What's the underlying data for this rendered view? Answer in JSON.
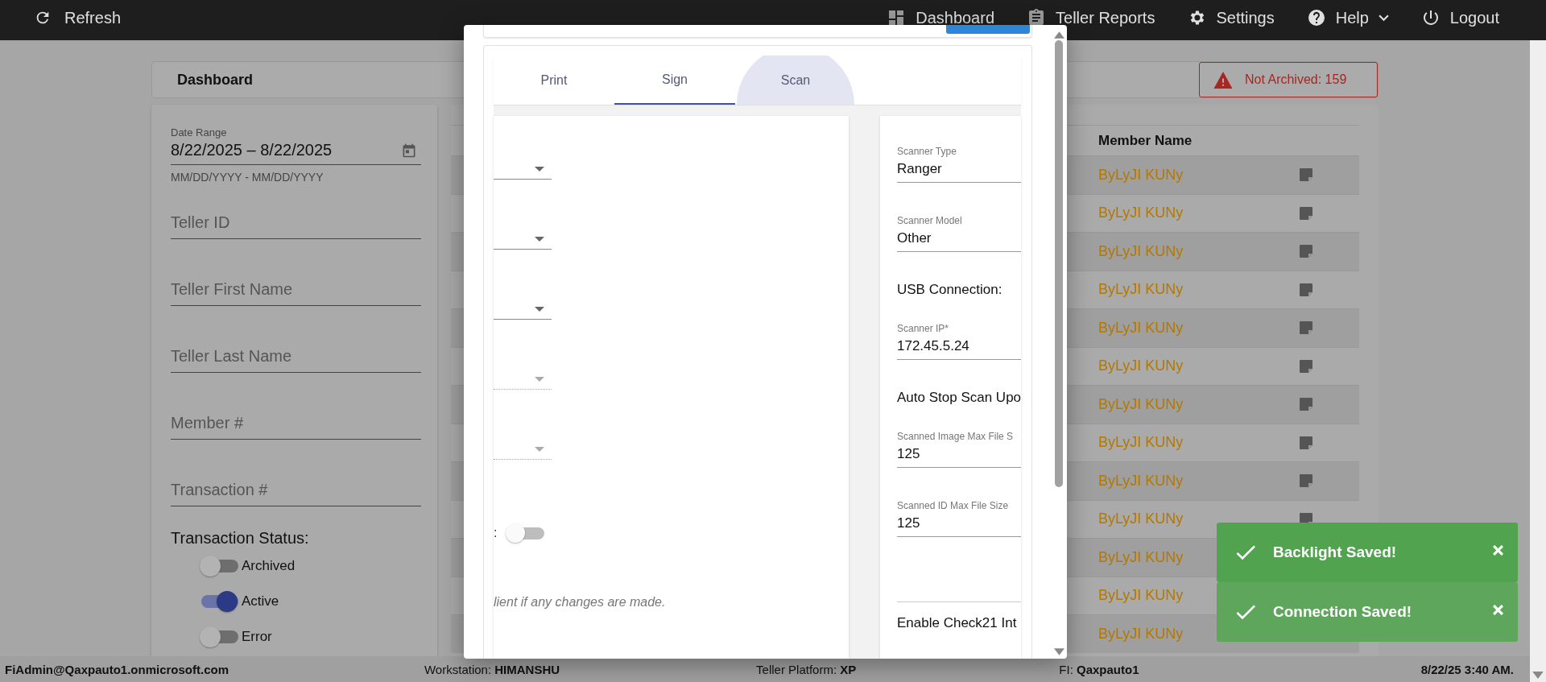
{
  "top_bar": {
    "refresh": "Refresh",
    "nav": [
      {
        "label": "Dashboard",
        "menu": false
      },
      {
        "label": "Teller Reports",
        "menu": false
      },
      {
        "label": "Settings",
        "menu": false
      },
      {
        "label": "Help",
        "menu": true
      },
      {
        "label": "Logout",
        "menu": false
      }
    ]
  },
  "header": {
    "title": "Dashboard",
    "alert": "Not Archived: 159"
  },
  "filters": {
    "date_range": {
      "label": "Date Range",
      "value": "8/22/2025 – 8/22/2025",
      "hint": "MM/DD/YYYY - MM/DD/YYYY"
    },
    "fields": [
      {
        "placeholder": "Teller ID"
      },
      {
        "placeholder": "Teller First Name"
      },
      {
        "placeholder": "Teller Last Name"
      },
      {
        "placeholder": "Member #"
      },
      {
        "placeholder": "Transaction #"
      }
    ],
    "status": {
      "title": "Transaction Status:",
      "options": [
        {
          "label": "Archived",
          "on": false
        },
        {
          "label": "Active",
          "on": true
        },
        {
          "label": "Error",
          "on": false
        }
      ]
    }
  },
  "table": {
    "columns": [
      "Member Name"
    ],
    "rows": [
      {
        "member_name": "ByLyJI KUNy",
        "note_icon": true
      },
      {
        "member_name": "ByLyJI KUNy",
        "note_icon": true
      },
      {
        "member_name": "ByLyJI KUNy",
        "note_icon": true
      },
      {
        "member_name": "ByLyJI KUNy",
        "note_icon": true
      },
      {
        "member_name": "ByLyJI KUNy",
        "note_icon": true
      },
      {
        "member_name": "ByLyJI KUNy",
        "note_icon": true
      },
      {
        "member_name": "ByLyJI KUNy",
        "note_icon": true
      },
      {
        "member_name": "ByLyJI KUNy",
        "note_icon": true
      },
      {
        "member_name": "ByLyJI KUNy",
        "note_icon": true
      },
      {
        "member_name": "ByLyJI KUNy",
        "note_icon": true
      },
      {
        "member_name": "ByLyJI KUNy",
        "note_icon": false
      },
      {
        "member_name": "ByLyJI KUNy",
        "note_icon": false
      },
      {
        "member_name": "ByLyJI KUNy",
        "note_icon": false
      }
    ]
  },
  "modal": {
    "tabs": [
      {
        "label": "Print",
        "selected": false
      },
      {
        "label": "Sign",
        "selected": true
      },
      {
        "label": "Scan",
        "selected": false
      }
    ],
    "left_panel": {
      "selects": [
        {
          "disabled": false
        },
        {
          "disabled": false
        },
        {
          "disabled": false
        },
        {
          "disabled": true
        },
        {
          "disabled": true
        }
      ],
      "toggle_label": ":",
      "toggle": {
        "on": false
      },
      "note": "lient if any changes are made."
    },
    "right_panel": [
      {
        "kind": "field",
        "label": "Scanner Type",
        "value": "Ranger"
      },
      {
        "kind": "field",
        "label": "Scanner Model",
        "value": "Other"
      },
      {
        "kind": "heading",
        "text": "USB Connection:",
        "rule": false
      },
      {
        "kind": "field",
        "label": "Scanner IP*",
        "value": "172.45.5.24"
      },
      {
        "kind": "heading",
        "text": "Auto Stop Scan Upo",
        "rule": false
      },
      {
        "kind": "field",
        "label": "Scanned Image Max File S",
        "value": "125"
      },
      {
        "kind": "field",
        "label": "Scanned ID Max File Size",
        "value": "125"
      },
      {
        "kind": "heading",
        "text": "Enable Check21 Int",
        "rule": true
      }
    ]
  },
  "toasts": [
    {
      "text": "Backlight Saved!"
    },
    {
      "text": "Connection Saved!"
    }
  ],
  "status_bar": {
    "user": "FiAdmin@Qaxpauto1.onmicrosoft.com",
    "workstation": "Workstation: **HIMANSHU**",
    "platform": "Teller Platform: **XP**",
    "fi": "FI: **Qaxpauto1**",
    "time": "8/22/25 3:40 AM."
  }
}
